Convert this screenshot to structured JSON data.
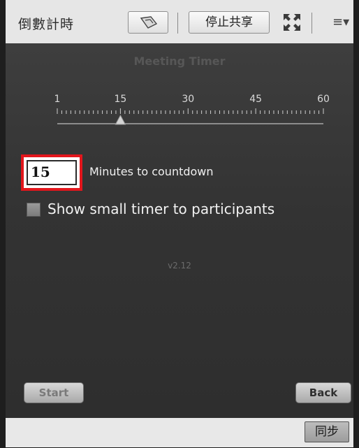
{
  "header": {
    "title": "倒數計時",
    "stop_share_label": "停止共享",
    "menu_glyph": "≡▾",
    "pointer_icon": "pointer-tool-icon",
    "fullscreen_icon": "fullscreen-icon"
  },
  "main": {
    "app_title": "Meeting Timer",
    "slider": {
      "tick_labels": [
        "1",
        "15",
        "30",
        "45",
        "60"
      ],
      "min": 1,
      "max": 60,
      "value": 15
    },
    "minutes": {
      "value": "15",
      "label": "Minutes to countdown"
    },
    "small_timer": {
      "label": "Show small timer to participants",
      "checked": false
    },
    "version": "v2.12",
    "start_label": "Start",
    "back_label": "Back"
  },
  "footer": {
    "sync_label": "同步"
  },
  "colors": {
    "highlight_border": "#e3161c",
    "panel_background": "#333333",
    "chrome_background": "#e6e6e6"
  }
}
